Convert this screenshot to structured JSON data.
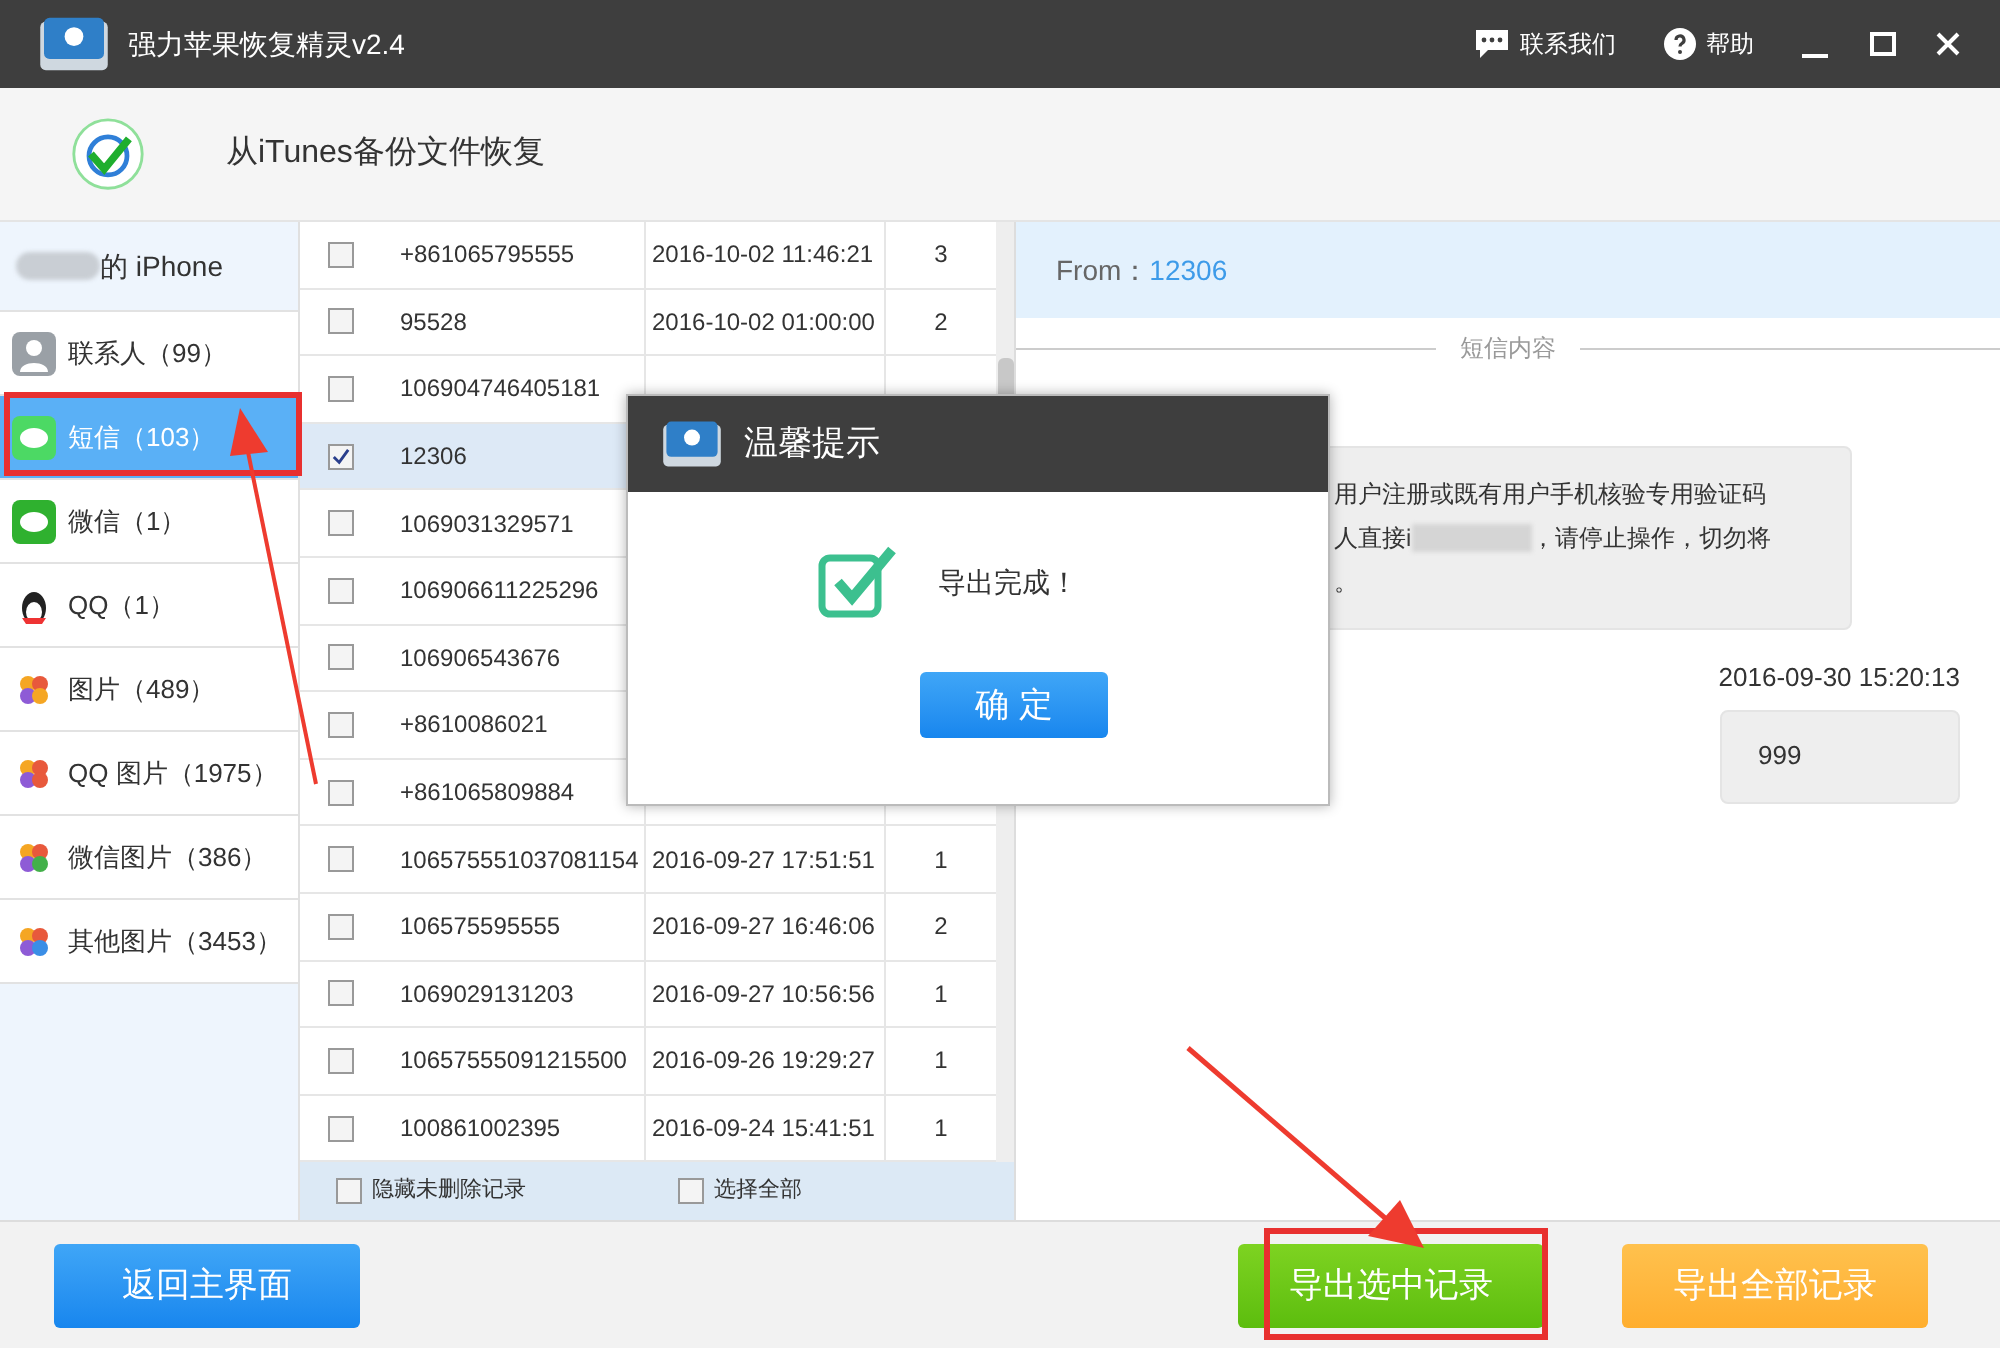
{
  "window": {
    "title": "强力苹果恢复精灵v2.4",
    "actions": [
      {
        "kind": "contact",
        "label": "联系我们"
      },
      {
        "kind": "help",
        "label": "帮助"
      }
    ]
  },
  "header": {
    "title": "从iTunes备份文件恢复"
  },
  "device": {
    "label": "的 iPhone"
  },
  "sidebar": {
    "items": [
      {
        "kind": "contacts",
        "label": "联系人（99）",
        "selected": false
      },
      {
        "kind": "messages",
        "label": "短信（103）",
        "selected": true
      },
      {
        "kind": "wechat",
        "label": "微信（1）",
        "selected": false
      },
      {
        "kind": "qq",
        "label": "QQ（1）",
        "selected": false
      },
      {
        "kind": "photos",
        "label": "图片（489）",
        "selected": false
      },
      {
        "kind": "qq_photos",
        "label": "QQ 图片（1975）",
        "selected": false
      },
      {
        "kind": "wechat_photos",
        "label": "微信图片（386）",
        "selected": false
      },
      {
        "kind": "other_photos",
        "label": "其他图片（3453）",
        "selected": false
      }
    ]
  },
  "table": {
    "rows": [
      {
        "number": "+861065795555",
        "date": "2016-10-02 11:46:21",
        "count": "3",
        "checked": false,
        "selected": false
      },
      {
        "number": "95528",
        "date": "2016-10-02 01:00:00",
        "count": "2",
        "checked": false,
        "selected": false
      },
      {
        "number": "106904746405181",
        "checked": false,
        "selected": false
      },
      {
        "number": "12306",
        "checked": true,
        "selected": true
      },
      {
        "number": "1069031329571",
        "checked": false,
        "selected": false
      },
      {
        "number": "106906611225296",
        "checked": false,
        "selected": false
      },
      {
        "number": "106906543676",
        "checked": false,
        "selected": false
      },
      {
        "number": "+8610086021",
        "checked": false,
        "selected": false
      },
      {
        "number": "+861065809884",
        "checked": false,
        "selected": false
      },
      {
        "number": "106575551037081154",
        "date": "2016-09-27 17:51:51",
        "count": "1",
        "checked": false,
        "selected": false
      },
      {
        "number": "106575595555",
        "date": "2016-09-27 16:46:06",
        "count": "2",
        "checked": false,
        "selected": false
      },
      {
        "number": "1069029131203",
        "date": "2016-09-27 10:56:56",
        "count": "1",
        "checked": false,
        "selected": false
      },
      {
        "number": "10657555091215500",
        "date": "2016-09-26 19:29:27",
        "count": "1",
        "checked": false,
        "selected": false
      },
      {
        "number": "100861002395",
        "date": "2016-09-24 15:41:51",
        "count": "1",
        "checked": false,
        "selected": false
      }
    ],
    "footer": [
      {
        "label": "隐藏未删除记录",
        "checked": false
      },
      {
        "label": "选择全部",
        "checked": false
      }
    ]
  },
  "detail": {
    "from_label": "From：",
    "from_value": "12306",
    "section": "短信内容",
    "messages": [
      {
        "kind": "received",
        "lines": [
          {
            "text": "用户注册或既有用户手机核验专用验证码"
          },
          {
            "text": "人直接i",
            "redacted": true,
            "rest": "，请停止操作，切勿将"
          },
          {
            "text": "。"
          }
        ]
      },
      {
        "kind": "sent",
        "time": "2016-09-30 15:20:13",
        "lines": [
          {
            "text": "999"
          }
        ]
      }
    ]
  },
  "buttons": [
    {
      "kind": "blue",
      "label": "返回主界面"
    },
    {
      "kind": "green",
      "label": "导出选中记录"
    },
    {
      "kind": "orange",
      "label": "导出全部记录"
    }
  ],
  "dialog": {
    "title": "温馨提示",
    "message": "导出完成！",
    "button": "确 定"
  }
}
